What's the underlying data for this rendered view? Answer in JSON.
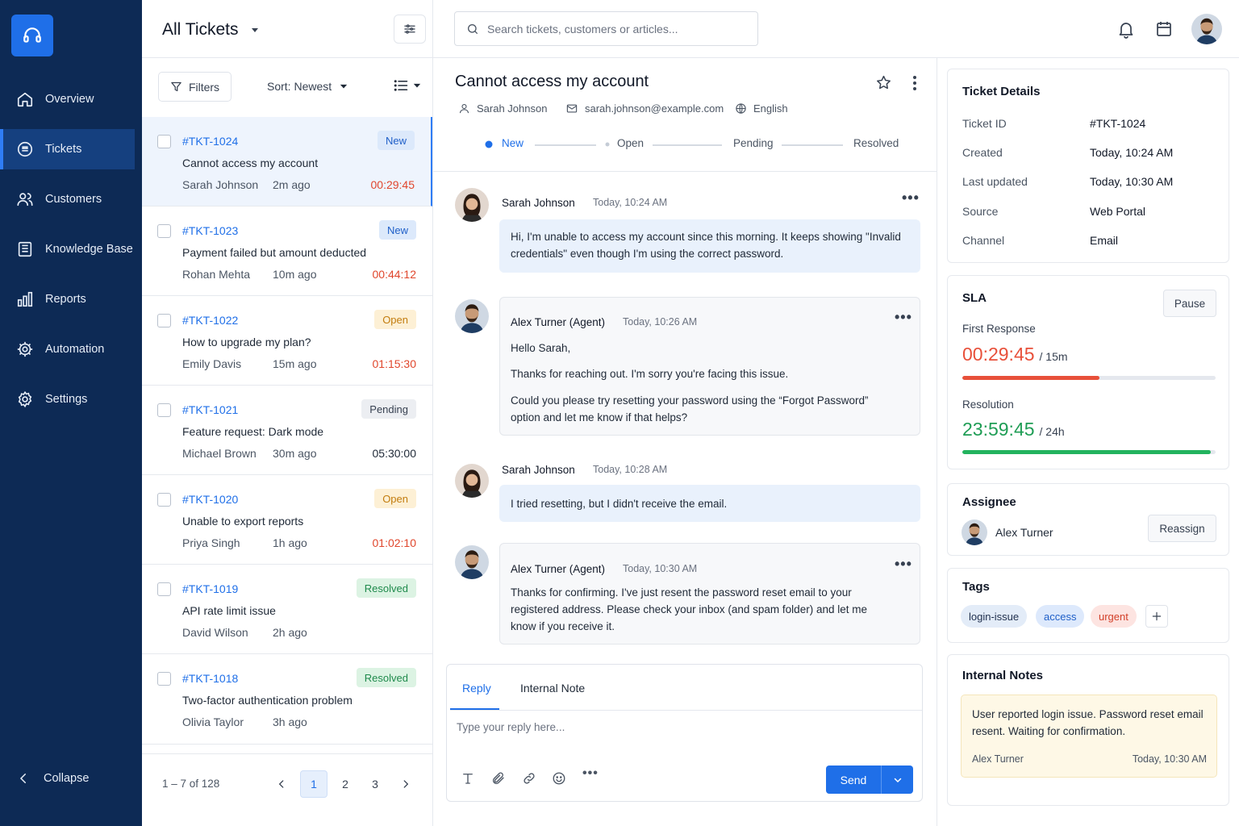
{
  "sidebar": {
    "items": [
      {
        "label": "Overview",
        "icon": "home-icon"
      },
      {
        "label": "Tickets",
        "icon": "ticket-icon"
      },
      {
        "label": "Customers",
        "icon": "users-icon"
      },
      {
        "label": "Knowledge Base",
        "icon": "book-icon"
      },
      {
        "label": "Reports",
        "icon": "bar-chart-icon"
      },
      {
        "label": "Automation",
        "icon": "cog-automation-icon"
      },
      {
        "label": "Settings",
        "icon": "gear-icon"
      }
    ],
    "active": "Tickets",
    "collapse_label": "Collapse"
  },
  "list": {
    "title": "All Tickets",
    "filters_label": "Filters",
    "sort_label": "Sort: Newest",
    "tickets": [
      {
        "id": "#TKT-1024",
        "subject": "Cannot access my account",
        "customer": "Sarah Johnson",
        "age": "2m ago",
        "timer": "00:29:45",
        "status": "New",
        "timer_color": "#e0462c"
      },
      {
        "id": "#TKT-1023",
        "subject": "Payment failed but amount deducted",
        "customer": "Rohan Mehta",
        "age": "10m ago",
        "timer": "00:44:12",
        "status": "New",
        "timer_color": "#e0462c"
      },
      {
        "id": "#TKT-1022",
        "subject": "How to upgrade my plan?",
        "customer": "Emily Davis",
        "age": "15m ago",
        "timer": "01:15:30",
        "status": "Open",
        "timer_color": "#e0462c"
      },
      {
        "id": "#TKT-1021",
        "subject": "Feature request: Dark mode",
        "customer": "Michael Brown",
        "age": "30m ago",
        "timer": "05:30:00",
        "status": "Pending",
        "timer_color": "#1f2937"
      },
      {
        "id": "#TKT-1020",
        "subject": "Unable to export reports",
        "customer": "Priya Singh",
        "age": "1h ago",
        "timer": "01:02:10",
        "status": "Open",
        "timer_color": "#e0462c"
      },
      {
        "id": "#TKT-1019",
        "subject": "API rate limit issue",
        "customer": "David Wilson",
        "age": "2h ago",
        "timer": "",
        "status": "Resolved",
        "timer_color": "#1f2937"
      },
      {
        "id": "#TKT-1018",
        "subject": "Two-factor authentication problem",
        "customer": "Olivia Taylor",
        "age": "3h ago",
        "timer": "",
        "status": "Resolved",
        "timer_color": "#1f2937"
      }
    ],
    "pagination": {
      "range": "1 – 7 of 128",
      "pages": [
        "1",
        "2",
        "3"
      ],
      "current": "1"
    }
  },
  "topbar": {
    "search_placeholder": "Search tickets, customers or articles..."
  },
  "ticket": {
    "title": "Cannot access my account",
    "customer": "Sarah Johnson",
    "email": "sarah.johnson@example.com",
    "language": "English",
    "stages": [
      "New",
      "Open",
      "Pending",
      "Resolved"
    ],
    "current_stage": "New"
  },
  "messages": [
    {
      "author": "Sarah Johnson",
      "time": "Today, 10:24 AM",
      "kind": "customer",
      "paragraphs": [
        "Hi, I'm unable to access my account since this morning. It keeps showing \"Invalid credentials\" even though I'm using the correct password."
      ]
    },
    {
      "author": "Alex Turner (Agent)",
      "time": "Today, 10:26 AM",
      "kind": "agent",
      "paragraphs": [
        "Hello Sarah,",
        "Thanks for reaching out. I'm sorry you're facing this issue.",
        "Could you please try resetting your password using the “Forgot Password” option and let me know if that helps?"
      ]
    },
    {
      "author": "Sarah Johnson",
      "time": "Today, 10:28 AM",
      "kind": "customer",
      "paragraphs": [
        "I tried resetting, but I didn't receive the email."
      ]
    },
    {
      "author": "Alex Turner (Agent)",
      "time": "Today, 10:30 AM",
      "kind": "agent",
      "paragraphs": [
        "Thanks for confirming. I've just resent the password reset email to your registered address. Please check your inbox (and spam folder) and let me know if you receive it."
      ]
    }
  ],
  "reply": {
    "tabs": [
      "Reply",
      "Internal Note"
    ],
    "active_tab": "Reply",
    "placeholder": "Type your reply here...",
    "send_label": "Send"
  },
  "details": {
    "title": "Ticket Details",
    "rows": [
      {
        "key": "Ticket ID",
        "value": "#TKT-1024"
      },
      {
        "key": "Created",
        "value": "Today, 10:24 AM"
      },
      {
        "key": "Last updated",
        "value": "Today, 10:30 AM"
      },
      {
        "key": "Source",
        "value": "Web Portal"
      },
      {
        "key": "Channel",
        "value": "Email"
      }
    ]
  },
  "sla": {
    "title": "SLA",
    "pause_label": "Pause",
    "first_response": {
      "label": "First Response",
      "value": "00:29:45",
      "target": "/ 15m",
      "progress": 0.54,
      "color": "#e8503a"
    },
    "resolution": {
      "label": "Resolution",
      "value": "23:59:45",
      "target": "/ 24h",
      "progress": 0.98,
      "color": "#22b35e"
    }
  },
  "assignee": {
    "title": "Assignee",
    "name": "Alex Turner",
    "reassign_label": "Reassign"
  },
  "tags": {
    "title": "Tags",
    "items": [
      {
        "label": "login-issue",
        "bg": "#e3ecf8",
        "fg": "#1f2f4d"
      },
      {
        "label": "access",
        "bg": "#dde9fc",
        "fg": "#1f5fc8"
      },
      {
        "label": "urgent",
        "bg": "#fde4e1",
        "fg": "#d2402a"
      }
    ]
  },
  "notes": {
    "title": "Internal Notes",
    "text": "User reported login issue. Password reset email resent. Waiting for confirmation.",
    "author": "Alex Turner",
    "time": "Today, 10:30 AM"
  }
}
